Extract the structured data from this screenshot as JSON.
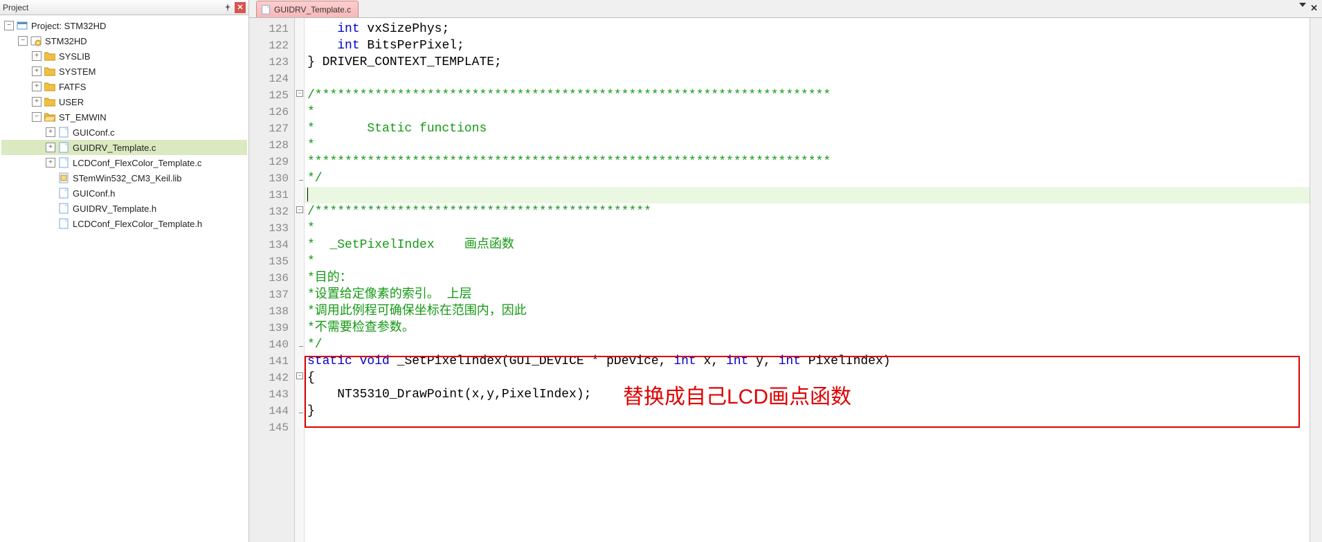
{
  "project_panel": {
    "title": "Project",
    "root": "Project: STM32HD",
    "target": "STM32HD",
    "groups": {
      "syslib": "SYSLIB",
      "system": "SYSTEM",
      "fatfs": "FATFS",
      "user": "USER",
      "st_emwin": "ST_EMWIN"
    },
    "files": {
      "guiconf_c": "GUIConf.c",
      "guidrv_c": "GUIDRV_Template.c",
      "lcdconf_c": "LCDConf_FlexColor_Template.c",
      "lib": "STemWin532_CM3_Keil.lib",
      "guiconf_h": "GUIConf.h",
      "guidrv_h": "GUIDRV_Template.h",
      "lcdconf_h": "LCDConf_FlexColor_Template.h"
    }
  },
  "editor": {
    "tab_label": "GUIDRV_Template.c"
  },
  "code": {
    "l121": {
      "kw": "int",
      "rest": " vxSizePhys;"
    },
    "l122": {
      "kw": "int",
      "rest": " BitsPerPixel;"
    },
    "l123": "} DRIVER_CONTEXT_TEMPLATE;",
    "l125": "/*********************************************************************",
    "l126": "*",
    "l127": "*       Static functions",
    "l128": "*",
    "l129": "**********************************************************************",
    "l130": "*/",
    "l132": "/*********************************************",
    "l133": "*",
    "l134": "*  _SetPixelIndex    画点函数",
    "l135": "*",
    "l136": "*目的：",
    "l137": "*设置给定像素的索引。 上层",
    "l138": "*调用此例程可确保坐标在范围内，因此",
    "l139": "*不需要检查参数。",
    "l140": "*/",
    "l141": {
      "kw1": "static",
      "kw2": "void",
      "fn": " _SetPixelIndex(GUI_DEVICE * pDevice, ",
      "kw3": "int",
      "p1": " x, ",
      "kw4": "int",
      "p2": " y, ",
      "kw5": "int",
      "p3": " PixelIndex)"
    },
    "l142": "{",
    "l143": "    NT35310_DrawPoint(x,y,PixelIndex);",
    "l144": "}"
  },
  "annotation": "替换成自己LCD画点函数",
  "line_numbers": [
    "121",
    "122",
    "123",
    "124",
    "125",
    "126",
    "127",
    "128",
    "129",
    "130",
    "131",
    "132",
    "133",
    "134",
    "135",
    "136",
    "137",
    "138",
    "139",
    "140",
    "141",
    "142",
    "143",
    "144",
    "145"
  ]
}
